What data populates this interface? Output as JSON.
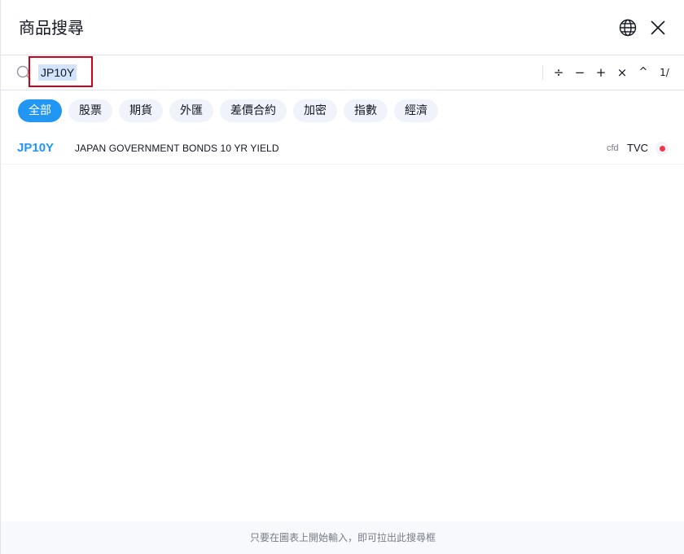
{
  "header": {
    "title": "商品搜尋",
    "globe_icon": "globe-icon",
    "close_icon": "close-icon"
  },
  "search": {
    "value": "JP10Y",
    "placeholder": "",
    "operators": {
      "divide": "÷",
      "minus": "−",
      "plus": "+",
      "times": "×",
      "power": "^",
      "reciprocal": "1/"
    }
  },
  "filters": [
    {
      "label": "全部",
      "active": true
    },
    {
      "label": "股票",
      "active": false
    },
    {
      "label": "期貨",
      "active": false
    },
    {
      "label": "外匯",
      "active": false
    },
    {
      "label": "差價合約",
      "active": false
    },
    {
      "label": "加密",
      "active": false
    },
    {
      "label": "指數",
      "active": false
    },
    {
      "label": "經濟",
      "active": false
    }
  ],
  "results": [
    {
      "symbol": "JP10Y",
      "description": "JAPAN GOVERNMENT BONDS 10 YR YIELD",
      "type": "cfd",
      "exchange": "TVC",
      "status_color": "#f23645"
    }
  ],
  "footer": {
    "hint": "只要在圖表上開始輸入，即可拉出此搜尋框"
  },
  "colors": {
    "accent": "#2196f3",
    "highlight_border": "#d0021b",
    "status_red": "#f23645"
  }
}
